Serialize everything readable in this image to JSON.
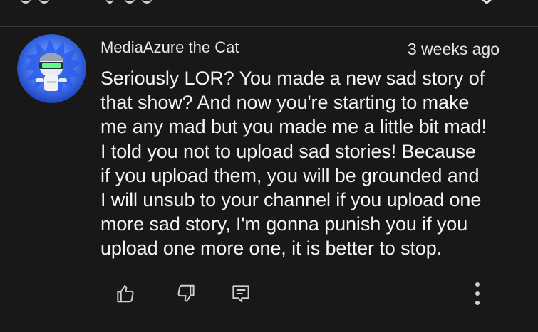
{
  "comment": {
    "author": "MediaAzure the Cat",
    "timestamp": "3 weeks ago",
    "lines": [
      "Seriously LOR? You made a new sad story of",
      "that show? And now you're starting to make",
      "me any mad but you made me a little bit mad!",
      "I told you not to upload sad stories! Because",
      "if you upload them, you will be grounded and",
      "I will unsub to your channel if you upload one",
      "more sad story, I'm gonna punish you if you",
      "upload one more one, it is better to stop."
    ]
  },
  "actions": {
    "like_icon": "thumbs-up-icon",
    "dislike_icon": "thumbs-down-icon",
    "reply_icon": "reply-comment-icon",
    "more_icon": "more-vertical-icon"
  },
  "colors": {
    "background": "#181818",
    "text": "#f1f1f1",
    "divider": "#3a3a3a",
    "icon": "#cfcfcf",
    "avatar_bg": "#1e4fd0"
  }
}
